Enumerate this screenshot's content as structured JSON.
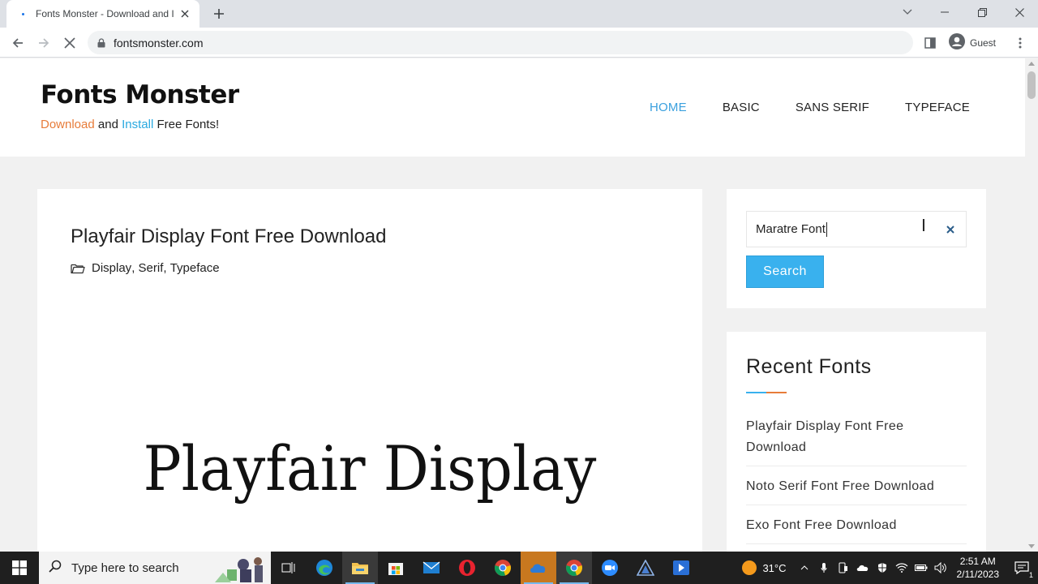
{
  "browser": {
    "tab_title": "Fonts Monster - Download and Install Free Fonts!",
    "url": "fontsmonster.com",
    "profile_label": "Guest"
  },
  "site": {
    "logo_title": "Fonts Monster",
    "tagline": {
      "part1": "Download",
      "part2": " and ",
      "part3": "Install",
      "part4": " Free Fonts!"
    },
    "nav": [
      "HOME",
      "BASIC",
      "SANS SERIF",
      "TYPEFACE"
    ],
    "nav_active": "HOME"
  },
  "post": {
    "title": "Playfair Display Font Free Download",
    "categories": [
      "Display",
      "Serif",
      "Typeface"
    ],
    "feature_text": "Playfair Display"
  },
  "sidebar": {
    "search_value": "Maratre Font",
    "search_button": "Search",
    "recent_title": "Recent Fonts",
    "recent": [
      "Playfair Display Font Free Download",
      "Noto Serif Font Free Download",
      "Exo Font Free Download"
    ]
  },
  "taskbar": {
    "search_placeholder": "Type here to search",
    "temperature": "31°C",
    "time": "2:51 AM",
    "date": "2/11/2023",
    "notification_count": "1"
  },
  "colors": {
    "accent_blue": "#39b1ee",
    "accent_orange": "#e77c3a",
    "nav_active": "#3aa0de"
  }
}
